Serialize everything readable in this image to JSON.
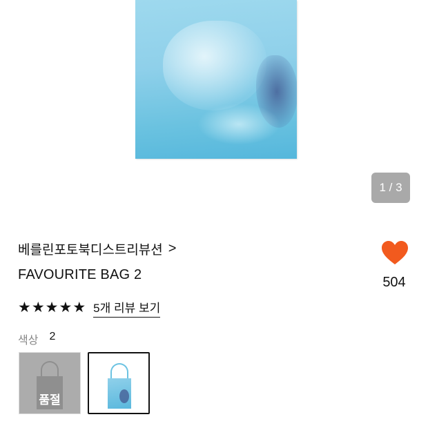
{
  "product": {
    "brand": "베를린포토북디스트리뷰션",
    "brand_chevron": ">",
    "name": "FAVOURITE BAG 2",
    "image_pager": "1 / 3",
    "image_index": 1,
    "image_total": 3
  },
  "likes": {
    "count": "504",
    "icon": "heart-icon",
    "color": "#f25a1e"
  },
  "rating": {
    "stars": 5,
    "star_glyph": "★",
    "reviews_link": "5개 리뷰 보기"
  },
  "color_options": {
    "label": "색상",
    "count": "2",
    "options": [
      {
        "badge": "품절",
        "sold_out": true,
        "selected": false
      },
      {
        "badge": "",
        "sold_out": false,
        "selected": true
      }
    ]
  }
}
